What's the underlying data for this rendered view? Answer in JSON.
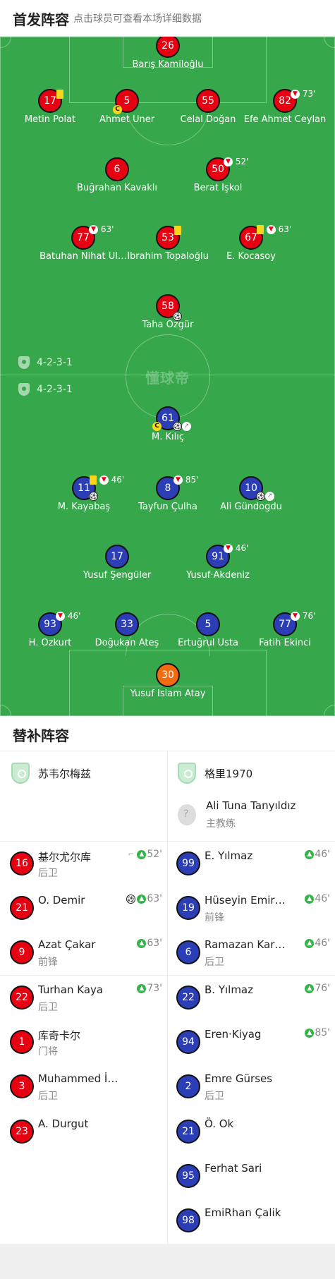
{
  "header": {
    "title": "首发阵容",
    "subtitle": "点击球员可查看本场详细数据"
  },
  "pitch": {
    "watermark": "懂球帝",
    "home_formation": "4-2-3-1",
    "away_formation": "4-2-3-1"
  },
  "home_players": [
    {
      "num": "26",
      "name": "Barış Kamiloğlu"
    },
    {
      "num": "17",
      "name": "Metin Polat"
    },
    {
      "num": "5",
      "name": "Ahmet Üner"
    },
    {
      "num": "55",
      "name": "Celal Doğan"
    },
    {
      "num": "82",
      "name": "Efe Ahmet Ceylan",
      "sub_min": "73'"
    },
    {
      "num": "6",
      "name": "Buğrahan Kavaklı"
    },
    {
      "num": "50",
      "name": "Berat İşkol",
      "sub_min": "52'"
    },
    {
      "num": "77",
      "name": "Batuhan Nihat Ul…",
      "sub_min": "63'"
    },
    {
      "num": "53",
      "name": "İbrahim Topaloğlu"
    },
    {
      "num": "67",
      "name": "E. Kocasoy",
      "sub_min": "63'"
    },
    {
      "num": "58",
      "name": "Taha Özgür"
    }
  ],
  "away_players": [
    {
      "num": "61",
      "name": "M. Kılıç"
    },
    {
      "num": "11",
      "name": "M. Kayabaş",
      "sub_min": "46'"
    },
    {
      "num": "8",
      "name": "Tayfun Çulha",
      "sub_min": "85'"
    },
    {
      "num": "10",
      "name": "Ali Gündogdu"
    },
    {
      "num": "17",
      "name": "Yusuf Şengüler"
    },
    {
      "num": "91",
      "name": "Yusuf·Akdeniz",
      "sub_min": "46'"
    },
    {
      "num": "93",
      "name": "H. Özkurt",
      "sub_min": "46'"
    },
    {
      "num": "33",
      "name": "Doğukan Ateş"
    },
    {
      "num": "5",
      "name": "Ertuğrul Usta"
    },
    {
      "num": "77",
      "name": "Fatih Ekinci",
      "sub_min": "76'"
    },
    {
      "num": "30",
      "name": "Yusuf İslam Atay"
    }
  ],
  "subs": {
    "title": "替补阵容",
    "home_team": "苏韦尔梅兹",
    "away_team": "格里1970",
    "away_coach": {
      "name": "Ali Tuna Tanyıldız",
      "role": "主教练"
    },
    "home": [
      {
        "num": "16",
        "name": "基尔尤尔库",
        "pos": "后卫",
        "min": "52'"
      },
      {
        "num": "21",
        "name": "O. Demir",
        "pos": "",
        "min": "63'"
      },
      {
        "num": "9",
        "name": "Azat Çakar",
        "pos": "前锋",
        "min": "63'"
      },
      {
        "num": "22",
        "name": "Turhan Kaya",
        "pos": "后卫",
        "min": "73'"
      },
      {
        "num": "1",
        "name": "库奇卡尔",
        "pos": "门将",
        "min": ""
      },
      {
        "num": "3",
        "name": "Muhammed İ…",
        "pos": "后卫",
        "min": ""
      },
      {
        "num": "23",
        "name": "A. Durgut",
        "pos": "",
        "min": ""
      }
    ],
    "away": [
      {
        "num": "99",
        "name": "E. Yılmaz",
        "pos": "",
        "min": "46'"
      },
      {
        "num": "19",
        "name": "Hüseyin Emir…",
        "pos": "前锋",
        "min": "46'"
      },
      {
        "num": "6",
        "name": "Ramazan Kar…",
        "pos": "后卫",
        "min": "46'"
      },
      {
        "num": "22",
        "name": "B. Yılmaz",
        "pos": "",
        "min": "76'"
      },
      {
        "num": "94",
        "name": "Eren·Kiyag",
        "pos": "",
        "min": "85'"
      },
      {
        "num": "2",
        "name": "Emre Gürses",
        "pos": "后卫",
        "min": ""
      },
      {
        "num": "21",
        "name": "Ö. Ok",
        "pos": "",
        "min": ""
      },
      {
        "num": "95",
        "name": "Ferhat Sari",
        "pos": "",
        "min": ""
      },
      {
        "num": "98",
        "name": "EmiRhan Çalik",
        "pos": "",
        "min": ""
      }
    ]
  }
}
